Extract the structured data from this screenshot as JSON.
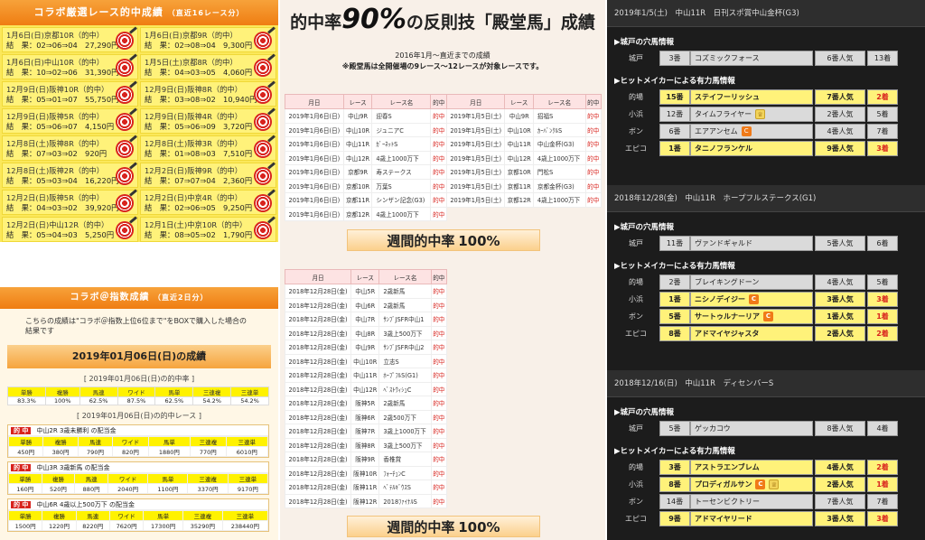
{
  "col1": {
    "header_title": "コラボ厳選レース的中成績",
    "header_sub": "（直近16レース分）",
    "hits": [
      {
        "title": "1月6日(日)京都10R（的中）",
        "result": "結　果：02⇒06⇒04　27,290円"
      },
      {
        "title": "1月6日(日)京都9R（的中）",
        "result": "結　果：02⇒08⇒04　9,300円"
      },
      {
        "title": "1月6日(日)中山10R（的中）",
        "result": "結　果：10⇒02⇒06　31,390円"
      },
      {
        "title": "1月5日(土)京都8R（的中）",
        "result": "結　果：04⇒03⇒05　4,060円"
      },
      {
        "title": "12月9日(日)阪神10R（的中）",
        "result": "結　果：05⇒01⇒07　55,750円"
      },
      {
        "title": "12月9日(日)阪神8R（的中）",
        "result": "結　果：03⇒08⇒02　10,940円"
      },
      {
        "title": "12月9日(日)阪神5R（的中）",
        "result": "結　果：05⇒06⇒07　4,150円"
      },
      {
        "title": "12月9日(日)阪神4R（的中）",
        "result": "結　果：05⇒06⇒09　3,720円"
      },
      {
        "title": "12月8日(土)阪神8R（的中）",
        "result": "結　果：07⇒03⇒02　920円"
      },
      {
        "title": "12月8日(土)阪神3R（的中）",
        "result": "結　果：01⇒08⇒03　7,510円"
      },
      {
        "title": "12月8日(土)阪神2R（的中）",
        "result": "結　果：05⇒03⇒04　16,220円"
      },
      {
        "title": "12月2日(日)阪神9R（的中）",
        "result": "結　果：07⇒07⇒04　2,360円"
      },
      {
        "title": "12月2日(日)阪神5R（的中）",
        "result": "結　果：04⇒03⇒02　39,920円"
      },
      {
        "title": "12月2日(日)中京4R（的中）",
        "result": "結　果：02⇒06⇒05　9,250円"
      },
      {
        "title": "12月2日(日)中山12R（的中）",
        "result": "結　果：05⇒04⇒03　5,250円"
      },
      {
        "title": "12月1日(土)中京10R（的中）",
        "result": "結　果：08⇒05⇒02　1,790円"
      }
    ],
    "sec2_title": "コラボ＠指数成績",
    "sec2_sub": "（直近2日分）",
    "sec2_note": "こちらの成績は\"コラボ＠指数上位6位まで\"をBOXで購入した場合の結果です",
    "date_bar": "2019年01月06日(日)の成績",
    "rate_caption": "[ 2019年01月06日(日)の的中率 ]",
    "rate_headers": [
      "単勝",
      "複勝",
      "馬連",
      "ワイド",
      "馬単",
      "三連複",
      "三連単"
    ],
    "rate_values": [
      "83.3%",
      "100%",
      "62.5%",
      "87.5%",
      "62.5%",
      "54.2%",
      "54.2%"
    ],
    "race_caption": "[ 2019年01月06日(日)の的中レース ]",
    "hit_tag": "的 中",
    "races": [
      {
        "name": "中山2R 3歳未勝利 の配当金",
        "values": [
          "450円",
          "380円",
          "790円",
          "820円",
          "1880円",
          "770円",
          "6010円"
        ]
      },
      {
        "name": "中山3R 3歳新馬 の配当金",
        "values": [
          "160円",
          "520円",
          "880円",
          "2040円",
          "1100円",
          "3370円",
          "9170円"
        ]
      },
      {
        "name": "中山6R 4歳以上500万下 の配当金",
        "values": [
          "1500円",
          "1220円",
          "8220円",
          "7620円",
          "17300円",
          "35290円",
          "238440円"
        ]
      }
    ]
  },
  "col2": {
    "title_pre": "的中率",
    "title_big": "90%",
    "title_post": "の反則技「殿堂馬」成績",
    "note1": "2016年1月～直近までの成績",
    "note2": "※殿堂馬は全開催場の9レース～12レースが対象レースです。",
    "headers": [
      "月日",
      "レース",
      "レース名",
      "的中"
    ],
    "table_a": [
      [
        "2019年1月6日(日)",
        "中山9R",
        "迎春S",
        "的中"
      ],
      [
        "2019年1月6日(日)",
        "中山10R",
        "ジュニアC",
        "的中"
      ],
      [
        "2019年1月6日(日)",
        "中山11R",
        "ｶﾞｰﾈｯﾄS",
        "的中"
      ],
      [
        "2019年1月6日(日)",
        "中山12R",
        "4歳上1000万下",
        "的中"
      ],
      [
        "2019年1月6日(日)",
        "京都9R",
        "寿ステークス",
        "的中"
      ],
      [
        "2019年1月6日(日)",
        "京都10R",
        "万葉S",
        "的中"
      ],
      [
        "2019年1月6日(日)",
        "京都11R",
        "シンザン記念(G3)",
        "的中"
      ],
      [
        "2019年1月6日(日)",
        "京都12R",
        "4歳上1000万下",
        "的中"
      ]
    ],
    "table_b": [
      [
        "2019年1月5日(土)",
        "中山9R",
        "招福S",
        "的中"
      ],
      [
        "2019年1月5日(土)",
        "中山10R",
        "ｶｰﾊﾞﾝｸﾙS",
        "的中"
      ],
      [
        "2019年1月5日(土)",
        "中山11R",
        "中山金杯(G3)",
        "的中"
      ],
      [
        "2019年1月5日(土)",
        "中山12R",
        "4歳上1000万下",
        "的中"
      ],
      [
        "2019年1月5日(土)",
        "京都10R",
        "門松S",
        "的中"
      ],
      [
        "2019年1月5日(土)",
        "京都11R",
        "京都金杯(G3)",
        "的中"
      ],
      [
        "2019年1月5日(土)",
        "京都12R",
        "4歳上1000万下",
        "的中"
      ]
    ],
    "weekly_label": "週間的中率",
    "weekly_value": "100%",
    "table_c": [
      [
        "2018年12月28日(金)",
        "中山5R",
        "2歳新馬",
        "的中"
      ],
      [
        "2018年12月28日(金)",
        "中山6R",
        "2歳新馬",
        "的中"
      ],
      [
        "2018年12月28日(金)",
        "中山7R",
        "ｻﾝﾌﾞJSFR中山1",
        "的中"
      ],
      [
        "2018年12月28日(金)",
        "中山8R",
        "3歳上500万下",
        "的中"
      ],
      [
        "2018年12月28日(金)",
        "中山9R",
        "ｻﾝﾌﾞJSFR中山2",
        "的中"
      ],
      [
        "2018年12月28日(金)",
        "中山10R",
        "立志S",
        "的中"
      ],
      [
        "2018年12月28日(金)",
        "中山11R",
        "ﾎｰﾌﾟﾌﾙS(G1)",
        "的中"
      ],
      [
        "2018年12月28日(金)",
        "中山12R",
        "ﾍﾞｽﾄｳｨｼｭC",
        "的中"
      ],
      [
        "2018年12月28日(金)",
        "阪神5R",
        "2歳新馬",
        "的中"
      ],
      [
        "2018年12月28日(金)",
        "阪神6R",
        "2歳500万下",
        "的中"
      ],
      [
        "2018年12月28日(金)",
        "阪神7R",
        "3歳上1000万下",
        "的中"
      ],
      [
        "2018年12月28日(金)",
        "阪神8R",
        "3歳上500万下",
        "的中"
      ],
      [
        "2018年12月28日(金)",
        "阪神9R",
        "香椎賞",
        "的中"
      ],
      [
        "2018年12月28日(金)",
        "阪神10R",
        "ﾌｫｰﾁｭﾝC",
        "的中"
      ],
      [
        "2018年12月28日(金)",
        "阪神11R",
        "ﾍﾞﾃﾙｷﾞｳｽS",
        "的中"
      ],
      [
        "2018年12月28日(金)",
        "阪神12R",
        "2018ﾌｧｲﾅﾙS",
        "的中"
      ]
    ]
  },
  "col3": {
    "races": [
      {
        "header": "2019年1/5(土)　中山11R　日刊スポ賞中山金杯(G3)",
        "ana_title": "▶城戸の穴馬情報",
        "ana": [
          {
            "lbl": "城戸",
            "num": "3番",
            "nm": "コズミックフォース",
            "pop": "6番人気",
            "fin": "13着",
            "top": false
          }
        ],
        "hit_title": "▶ヒットメイカーによる有力馬情報",
        "hits": [
          {
            "lbl": "的場",
            "num": "15番",
            "nm": "ステイフーリッシュ",
            "pop": "7番人気",
            "fin": "2着",
            "top": true,
            "y": true,
            "badge": ""
          },
          {
            "lbl": "小浜",
            "num": "12番",
            "nm": "タイムフライヤー",
            "pop": "2番人気",
            "fin": "5着",
            "top": false,
            "y": false,
            "badge": "k"
          },
          {
            "lbl": "ボン",
            "num": "6番",
            "nm": "エアアンセム",
            "pop": "4番人気",
            "fin": "7着",
            "top": false,
            "y": false,
            "badge": "c"
          },
          {
            "lbl": "エピコ",
            "num": "1番",
            "nm": "タニノフランケル",
            "pop": "9番人気",
            "fin": "3着",
            "top": true,
            "y": true,
            "badge": ""
          }
        ]
      },
      {
        "header": "2018年12/28(金)　中山11R　ホープフルステークス(G1)",
        "ana_title": "▶城戸の穴馬情報",
        "ana": [
          {
            "lbl": "城戸",
            "num": "11番",
            "nm": "ヴァンドギャルド",
            "pop": "5番人気",
            "fin": "6着",
            "top": false
          }
        ],
        "hit_title": "▶ヒットメイカーによる有力馬情報",
        "hits": [
          {
            "lbl": "的場",
            "num": "2番",
            "nm": "ブレイキングドーン",
            "pop": "4番人気",
            "fin": "5着",
            "top": false,
            "y": false,
            "badge": ""
          },
          {
            "lbl": "小浜",
            "num": "1番",
            "nm": "ニシノデイジー",
            "pop": "3番人気",
            "fin": "3着",
            "top": true,
            "y": true,
            "badge": "c"
          },
          {
            "lbl": "ボン",
            "num": "5番",
            "nm": "サートゥルナーリア",
            "pop": "1番人気",
            "fin": "1着",
            "top": true,
            "y": true,
            "badge": "c"
          },
          {
            "lbl": "エピコ",
            "num": "8番",
            "nm": "アドマイヤジャスタ",
            "pop": "2番人気",
            "fin": "2着",
            "top": true,
            "y": true,
            "badge": ""
          }
        ]
      },
      {
        "header": "2018年12/16(日)　中山11R　ディセンバーS",
        "ana_title": "▶城戸の穴馬情報",
        "ana": [
          {
            "lbl": "城戸",
            "num": "5番",
            "nm": "ゲッカコウ",
            "pop": "8番人気",
            "fin": "4着",
            "top": false
          }
        ],
        "hit_title": "▶ヒットメイカーによる有力馬情報",
        "hits": [
          {
            "lbl": "的場",
            "num": "3番",
            "nm": "アストラエンブレム",
            "pop": "4番人気",
            "fin": "2着",
            "top": true,
            "y": true,
            "badge": ""
          },
          {
            "lbl": "小浜",
            "num": "8番",
            "nm": "プロディガルサン",
            "pop": "2番人気",
            "fin": "1着",
            "top": true,
            "y": true,
            "badge": "ck"
          },
          {
            "lbl": "ボン",
            "num": "14番",
            "nm": "トーセンビクトリー",
            "pop": "7番人気",
            "fin": "7着",
            "top": false,
            "y": false,
            "badge": ""
          },
          {
            "lbl": "エピコ",
            "num": "9番",
            "nm": "アドマイヤリード",
            "pop": "3番人気",
            "fin": "3着",
            "top": true,
            "y": true,
            "badge": ""
          }
        ]
      }
    ]
  }
}
